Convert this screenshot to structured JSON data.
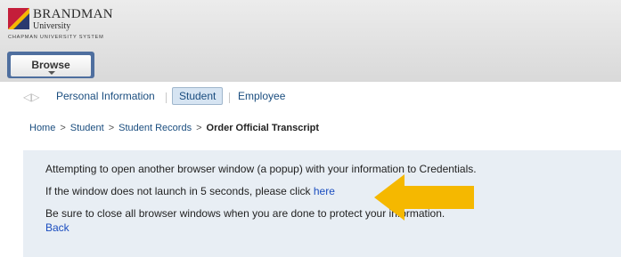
{
  "logo": {
    "brand": "BRANDMAN",
    "university": "University",
    "system": "CHAPMAN UNIVERSITY SYSTEM"
  },
  "browse": {
    "label": "Browse"
  },
  "tabs": [
    {
      "label": "Personal Information",
      "active": false
    },
    {
      "label": "Student",
      "active": true
    },
    {
      "label": "Employee",
      "active": false
    }
  ],
  "breadcrumb": [
    {
      "label": "Home"
    },
    {
      "label": "Student"
    },
    {
      "label": "Student Records"
    },
    {
      "label": "Order Official Transcript",
      "current": true
    }
  ],
  "breadcrumb_separator": ">",
  "message": {
    "line1": "Attempting to open another browser window (a popup) with your information to Credentials.",
    "line2_prefix": "If the window does not launch in 5 seconds, please click ",
    "line2_link": "here",
    "line3": "Be sure to close all browser windows when you are done to protect your information.",
    "back_link": "Back"
  },
  "icons": {
    "nav_arrows": "left-right-arrows-icon",
    "pointer": "yellow-pointer-arrow-icon"
  },
  "colors": {
    "header_bg": "#e0e0e0",
    "browse_border": "#4f6f9f",
    "link": "#1a4d7f",
    "panel_bg": "#e8eef4",
    "arrow": "#f5b800",
    "logo_red": "#c41e3a",
    "logo_yellow": "#f5b800"
  }
}
